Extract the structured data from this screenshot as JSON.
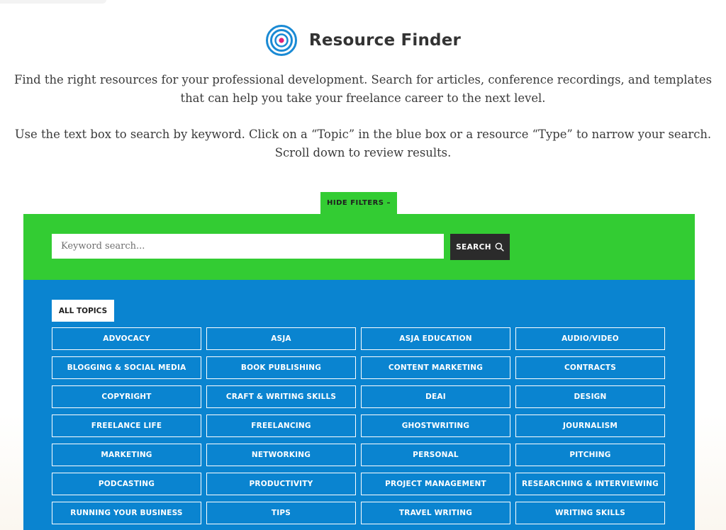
{
  "header": {
    "title": "Resource Finder",
    "logo_icon": "target-icon"
  },
  "intro": {
    "paragraph_1": "Find the right resources for your professional development. Search for articles, conference recordings, and templates that can help you take your freelance career to the next level.",
    "paragraph_2": "Use the text box to search by keyword. Click on a “Topic” in the blue box or a resource “Type” to narrow your search. Scroll down to review results."
  },
  "filters": {
    "toggle_label": "HIDE FILTERS –",
    "search": {
      "placeholder": "Keyword search...",
      "value": "",
      "button_label": "SEARCH"
    },
    "all_topics_label": "ALL TOPICS",
    "topics": [
      "ADVOCACY",
      "ASJA",
      "ASJA EDUCATION",
      "AUDIO/VIDEO",
      "BLOGGING & SOCIAL MEDIA",
      "BOOK PUBLISHING",
      "CONTENT MARKETING",
      "CONTRACTS",
      "COPYRIGHT",
      "CRAFT & WRITING SKILLS",
      "DEAI",
      "DESIGN",
      "FREELANCE LIFE",
      "FREELANCING",
      "GHOSTWRITING",
      "JOURNALISM",
      "MARKETING",
      "NETWORKING",
      "PERSONAL",
      "PITCHING",
      "PODCASTING",
      "PRODUCTIVITY",
      "PROJECT MANAGEMENT",
      "RESEARCHING & INTERVIEWING",
      "RUNNING YOUR BUSINESS",
      "TIPS",
      "TRAVEL WRITING",
      "WRITING SKILLS"
    ]
  },
  "colors": {
    "green_band": "#33cc33",
    "blue_panel": "#0a84d0",
    "dark_button": "#2b2b2b",
    "logo_blue": "#1a8ad4",
    "logo_center": "#e0207a"
  }
}
